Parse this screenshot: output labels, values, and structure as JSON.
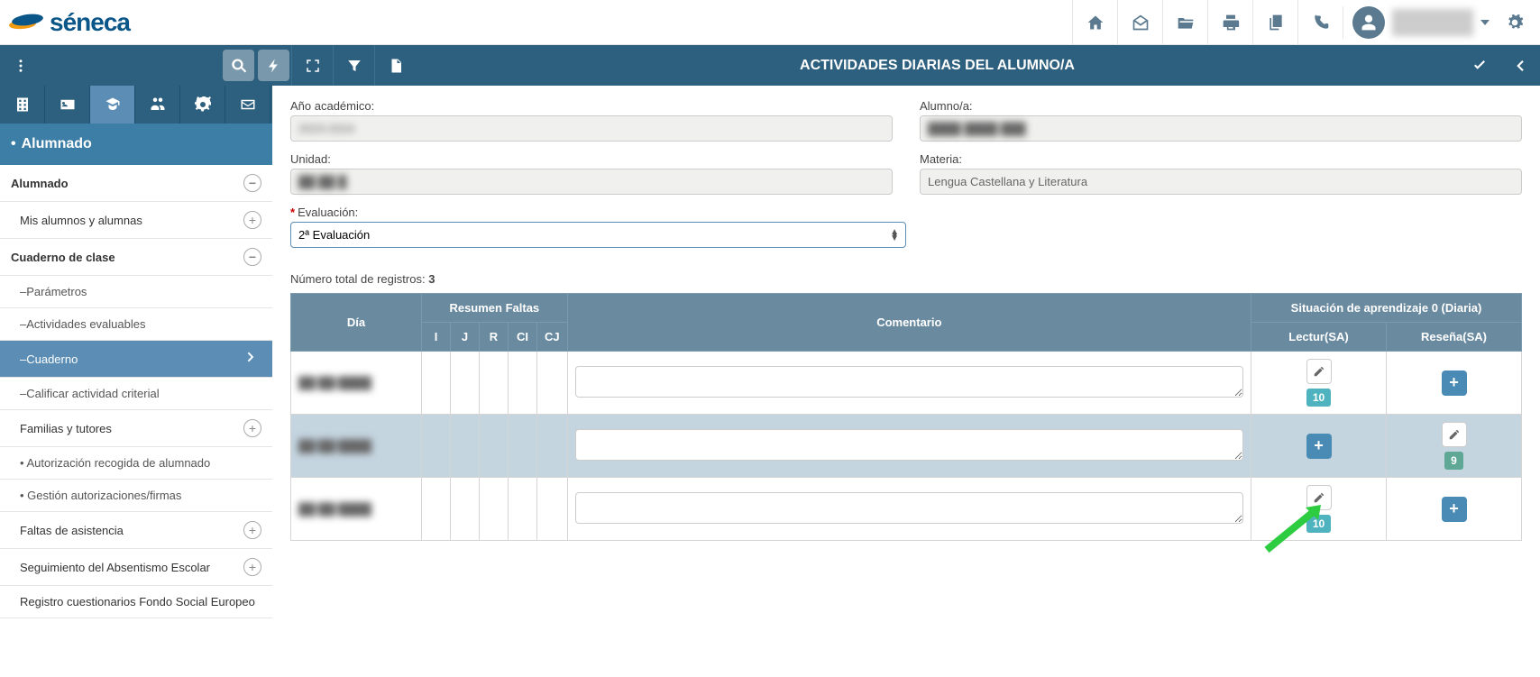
{
  "header": {
    "logo": "séneca"
  },
  "toolbar": {
    "title": "ACTIVIDADES DIARIAS DEL ALUMNO/A"
  },
  "breadcrumb": "Alumnado",
  "nav": {
    "alumnado": "Alumnado",
    "mis_alumnos": "Mis alumnos y alumnas",
    "cuaderno": "Cuaderno de clase",
    "parametros": "–Parámetros",
    "actividades_eval": "–Actividades evaluables",
    "cuaderno_item": "–Cuaderno",
    "calificar": "–Calificar actividad criterial",
    "familias": "Familias y tutores",
    "autorizacion": "Autorización recogida de alumnado",
    "gestion_autor": "Gestión autorizaciones/firmas",
    "faltas": "Faltas de asistencia",
    "absentismo": "Seguimiento del Absentismo Escolar",
    "registro": "Registro cuestionarios Fondo Social Europeo"
  },
  "form": {
    "labels": {
      "ano": "Año académico:",
      "alumno": "Alumno/a:",
      "unidad": "Unidad:",
      "materia": "Materia:",
      "evaluacion": "Evaluación:"
    },
    "values": {
      "ano": "2023-2024",
      "alumno": "████ ████ ███",
      "unidad": "██ ██ █",
      "materia": "Lengua Castellana y Literatura",
      "evaluacion": "2ª Evaluación"
    }
  },
  "records": {
    "label": "Número total de registros:",
    "count": "3"
  },
  "table": {
    "headers": {
      "dia": "Día",
      "resumen": "Resumen Faltas",
      "i": "I",
      "j": "J",
      "r": "R",
      "ci": "CI",
      "cj": "CJ",
      "comentario": "Comentario",
      "situacion": "Situación de aprendizaje 0 (Diaria)",
      "lectur": "Lectur(SA)",
      "resena": "Reseña(SA)"
    },
    "rows": [
      {
        "day": "██/██/████",
        "lectur_score": "10",
        "lectur_mode": "edit",
        "resena_mode": "add"
      },
      {
        "day": "██/██/████",
        "lectur_mode": "add",
        "resena_score": "9",
        "resena_mode": "edit"
      },
      {
        "day": "██/██/████",
        "lectur_score": "10",
        "lectur_mode": "edit",
        "resena_mode": "add"
      }
    ]
  }
}
